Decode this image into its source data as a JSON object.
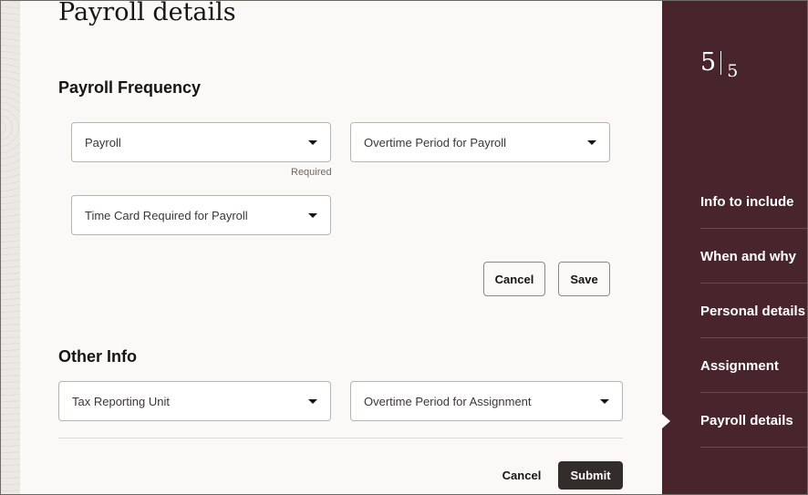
{
  "page": {
    "title": "Payroll details"
  },
  "payroll_frequency": {
    "section_title": "Payroll Frequency",
    "payroll_select": {
      "value": "Payroll",
      "helper": "Required"
    },
    "overtime_period_payroll_select": {
      "value": "Overtime Period for Payroll"
    },
    "time_card_required_select": {
      "value": "Time Card Required for Payroll"
    },
    "cancel_label": "Cancel",
    "save_label": "Save"
  },
  "other_info": {
    "section_title": "Other Info",
    "tax_reporting_unit_select": {
      "value": "Tax Reporting Unit"
    },
    "overtime_period_assignment_select": {
      "value": "Overtime Period for Assignment"
    }
  },
  "footer": {
    "cancel_label": "Cancel",
    "submit_label": "Submit"
  },
  "sidebar": {
    "step_current": "5",
    "step_total": "5",
    "items": [
      {
        "label": "Info to include"
      },
      {
        "label": "When and why"
      },
      {
        "label": "Personal details"
      },
      {
        "label": "Assignment"
      },
      {
        "label": "Payroll details",
        "active": true
      }
    ]
  },
  "colors": {
    "sidebar_bg": "#48252d",
    "primary_button": "#312d2a",
    "panel_bg": "#fbf9f8"
  }
}
